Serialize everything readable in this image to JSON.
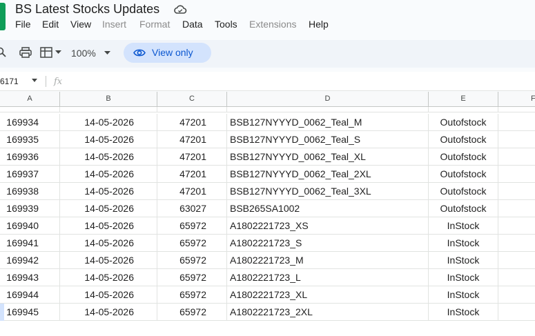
{
  "app": {
    "title": "BS Latest Stocks Updates",
    "accent": "#0b57d0",
    "brand": "#0f9d58"
  },
  "menu": [
    {
      "label": "File",
      "enabled": true
    },
    {
      "label": "Edit",
      "enabled": true
    },
    {
      "label": "View",
      "enabled": true
    },
    {
      "label": "Insert",
      "enabled": false
    },
    {
      "label": "Format",
      "enabled": false
    },
    {
      "label": "Data",
      "enabled": true
    },
    {
      "label": "Tools",
      "enabled": true
    },
    {
      "label": "Extensions",
      "enabled": false
    },
    {
      "label": "Help",
      "enabled": true
    }
  ],
  "toolbar": {
    "zoom": "100%",
    "view_only_label": "View only"
  },
  "formula_bar": {
    "name_box": "6171",
    "fx": "fx"
  },
  "columns": [
    "A",
    "B",
    "C",
    "D",
    "E",
    "F"
  ],
  "rows": [
    {
      "a": "169934",
      "b": "14-05-2026",
      "c": "47201",
      "d": "BSB127NYYYD_0062_Teal_M",
      "e": "Outofstock"
    },
    {
      "a": "169935",
      "b": "14-05-2026",
      "c": "47201",
      "d": "BSB127NYYYD_0062_Teal_S",
      "e": "Outofstock"
    },
    {
      "a": "169936",
      "b": "14-05-2026",
      "c": "47201",
      "d": "BSB127NYYYD_0062_Teal_XL",
      "e": "Outofstock"
    },
    {
      "a": "169937",
      "b": "14-05-2026",
      "c": "47201",
      "d": "BSB127NYYYD_0062_Teal_2XL",
      "e": "Outofstock"
    },
    {
      "a": "169938",
      "b": "14-05-2026",
      "c": "47201",
      "d": "BSB127NYYYD_0062_Teal_3XL",
      "e": "Outofstock"
    },
    {
      "a": "169939",
      "b": "14-05-2026",
      "c": "63027",
      "d": "BSB265SA1002",
      "e": "Outofstock"
    },
    {
      "a": "169940",
      "b": "14-05-2026",
      "c": "65972",
      "d": "A1802221723_XS",
      "e": "InStock"
    },
    {
      "a": "169941",
      "b": "14-05-2026",
      "c": "65972",
      "d": "A1802221723_S",
      "e": "InStock"
    },
    {
      "a": "169942",
      "b": "14-05-2026",
      "c": "65972",
      "d": "A1802221723_M",
      "e": "InStock"
    },
    {
      "a": "169943",
      "b": "14-05-2026",
      "c": "65972",
      "d": "A1802221723_L",
      "e": "InStock"
    },
    {
      "a": "169944",
      "b": "14-05-2026",
      "c": "65972",
      "d": "A1802221723_XL",
      "e": "InStock"
    },
    {
      "a": "169945",
      "b": "14-05-2026",
      "c": "65972",
      "d": "A1802221723_2XL",
      "e": "InStock"
    }
  ]
}
